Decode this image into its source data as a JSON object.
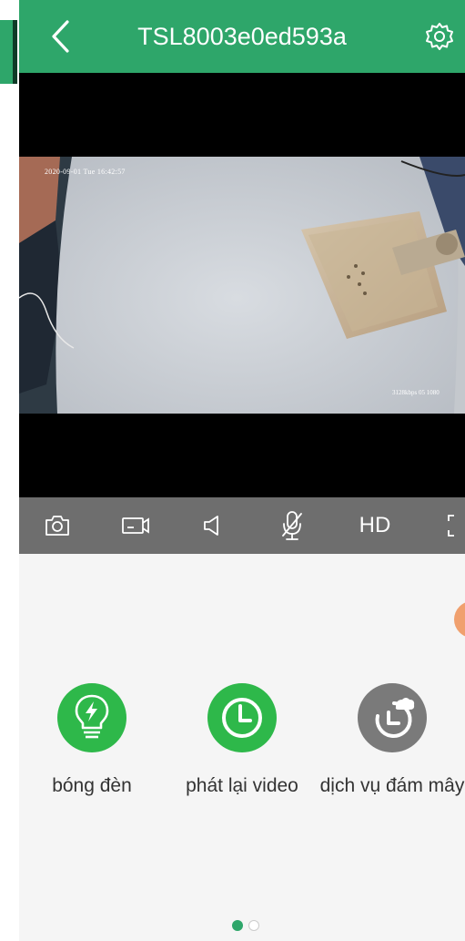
{
  "header": {
    "title": "TSL8003e0ed593a",
    "back_icon": "chevron-left-icon",
    "settings_icon": "gear-icon"
  },
  "video": {
    "timestamp_top": "2020-09-01 Tue 16:42:57",
    "timestamp_bottom": "3128kbps 05 1080"
  },
  "controls": [
    {
      "icon": "camera-icon"
    },
    {
      "icon": "record-video-icon"
    },
    {
      "icon": "speaker-icon"
    },
    {
      "icon": "mic-muted-icon"
    },
    {
      "label": "HD"
    },
    {
      "icon": "fullscreen-icon"
    }
  ],
  "features": [
    {
      "label": "bóng đèn",
      "icon": "lightbulb-icon",
      "color": "#2eb84a"
    },
    {
      "label": "phát lại video",
      "icon": "clock-icon",
      "color": "#2eb84a"
    },
    {
      "label": "dịch vụ đám mây",
      "icon": "cloud-clock-icon",
      "color": "#7a7a7a"
    }
  ],
  "pager": {
    "pages": 2,
    "active": 1
  },
  "colors": {
    "brand_green": "#2ea66a",
    "control_bar": "#6e6e6e"
  }
}
